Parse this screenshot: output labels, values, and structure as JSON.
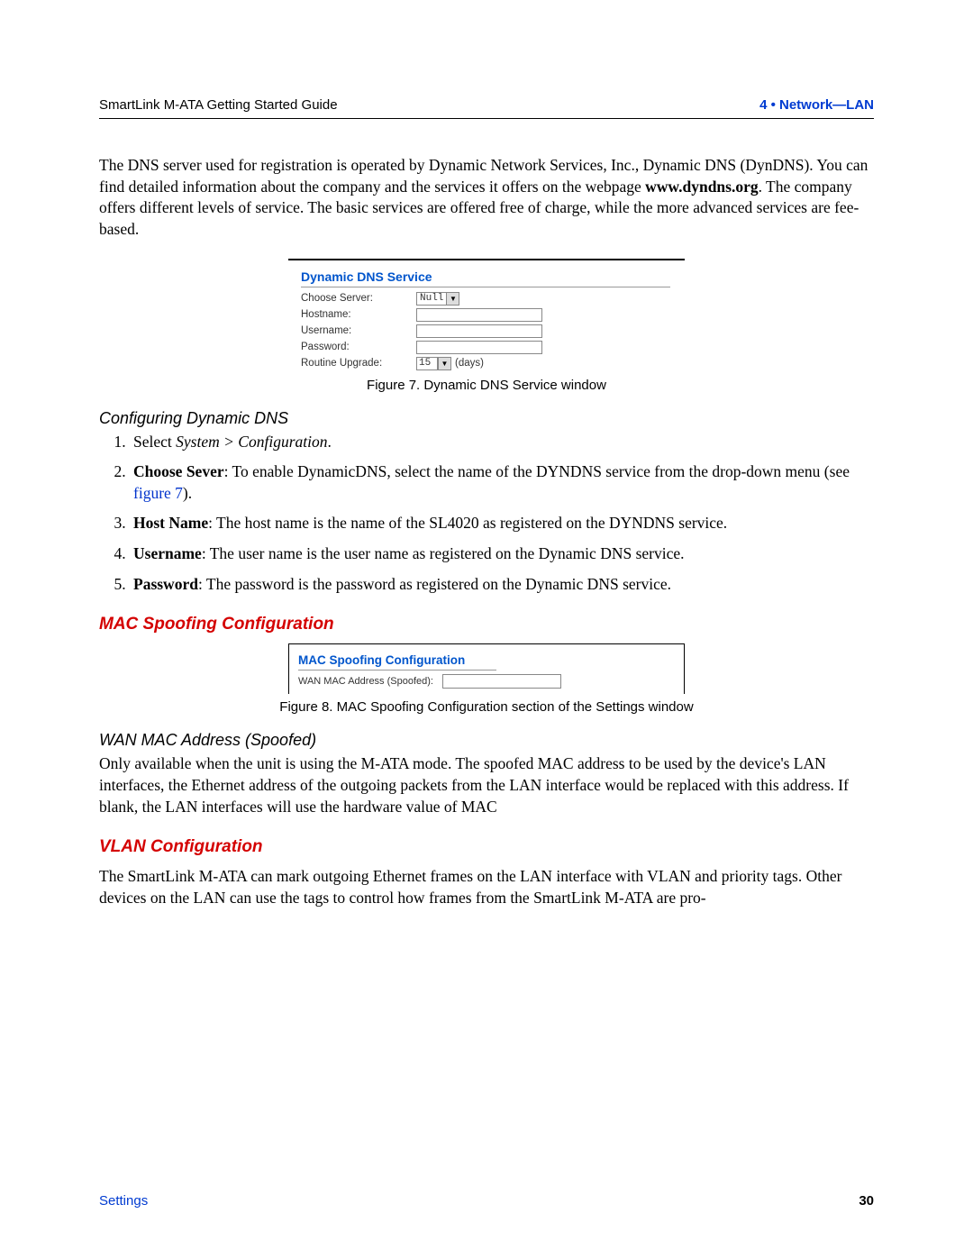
{
  "header": {
    "left": "SmartLink M-ATA Getting Started Guide",
    "right": "4 • Network—LAN"
  },
  "intro": "The DNS server used for registration is operated by Dynamic Network Services, Inc., Dynamic DNS (DynDNS). You can find detailed information about the company and the services it offers on the webpage ",
  "intro_bold": "www.dyndns.org",
  "intro_tail": ". The company offers different levels of service. The basic services are offered free of charge, while the more advanced services are fee-based.",
  "fig7": {
    "panel_title": "Dynamic DNS Service",
    "rows": {
      "choose_server_label": "Choose Server:",
      "choose_server_value": "Null",
      "hostname_label": "Hostname:",
      "username_label": "Username:",
      "password_label": "Password:",
      "routine_label": "Routine Upgrade:",
      "routine_value": "15",
      "routine_unit": "(days)"
    },
    "caption": "Figure 7. Dynamic DNS Service window"
  },
  "config_dns": {
    "heading": "Configuring Dynamic DNS",
    "steps": [
      {
        "pre": "Select ",
        "ital": "System > Configuration",
        "post": "."
      },
      {
        "bold": "Choose Sever",
        "text": ": To enable DynamicDNS, select the name of the DYNDNS service from the drop-down menu (see ",
        "link": "figure 7",
        "tail": ")."
      },
      {
        "bold": "Host Name",
        "text": ": The host name is the name of the SL4020 as registered on the DYNDNS service."
      },
      {
        "bold": "Username",
        "text": ": The user name is the user name as registered on the Dynamic DNS service."
      },
      {
        "bold": "Password",
        "text": ": The password is the password as registered on the Dynamic DNS service."
      }
    ]
  },
  "mac": {
    "section_heading": "MAC Spoofing Configuration",
    "panel_title": "MAC Spoofing Configuration",
    "row_label": "WAN MAC Address (Spoofed):",
    "caption": "Figure 8. MAC Spoofing Configuration section of the Settings window",
    "sub_heading": "WAN MAC Address (Spoofed)",
    "body": "Only available when the unit is using the M-ATA mode. The spoofed MAC address to be used by the device's LAN interfaces, the Ethernet address of the outgoing packets from the LAN interface would be replaced with this address. If blank, the LAN interfaces will use the hardware value of MAC"
  },
  "vlan": {
    "section_heading": "VLAN Configuration",
    "body": "The SmartLink M-ATA can mark outgoing Ethernet frames on the LAN interface with VLAN and priority tags. Other devices on the LAN can use the tags to control how frames from the SmartLink M-ATA are pro-"
  },
  "footer": {
    "left": "Settings",
    "right": "30"
  }
}
